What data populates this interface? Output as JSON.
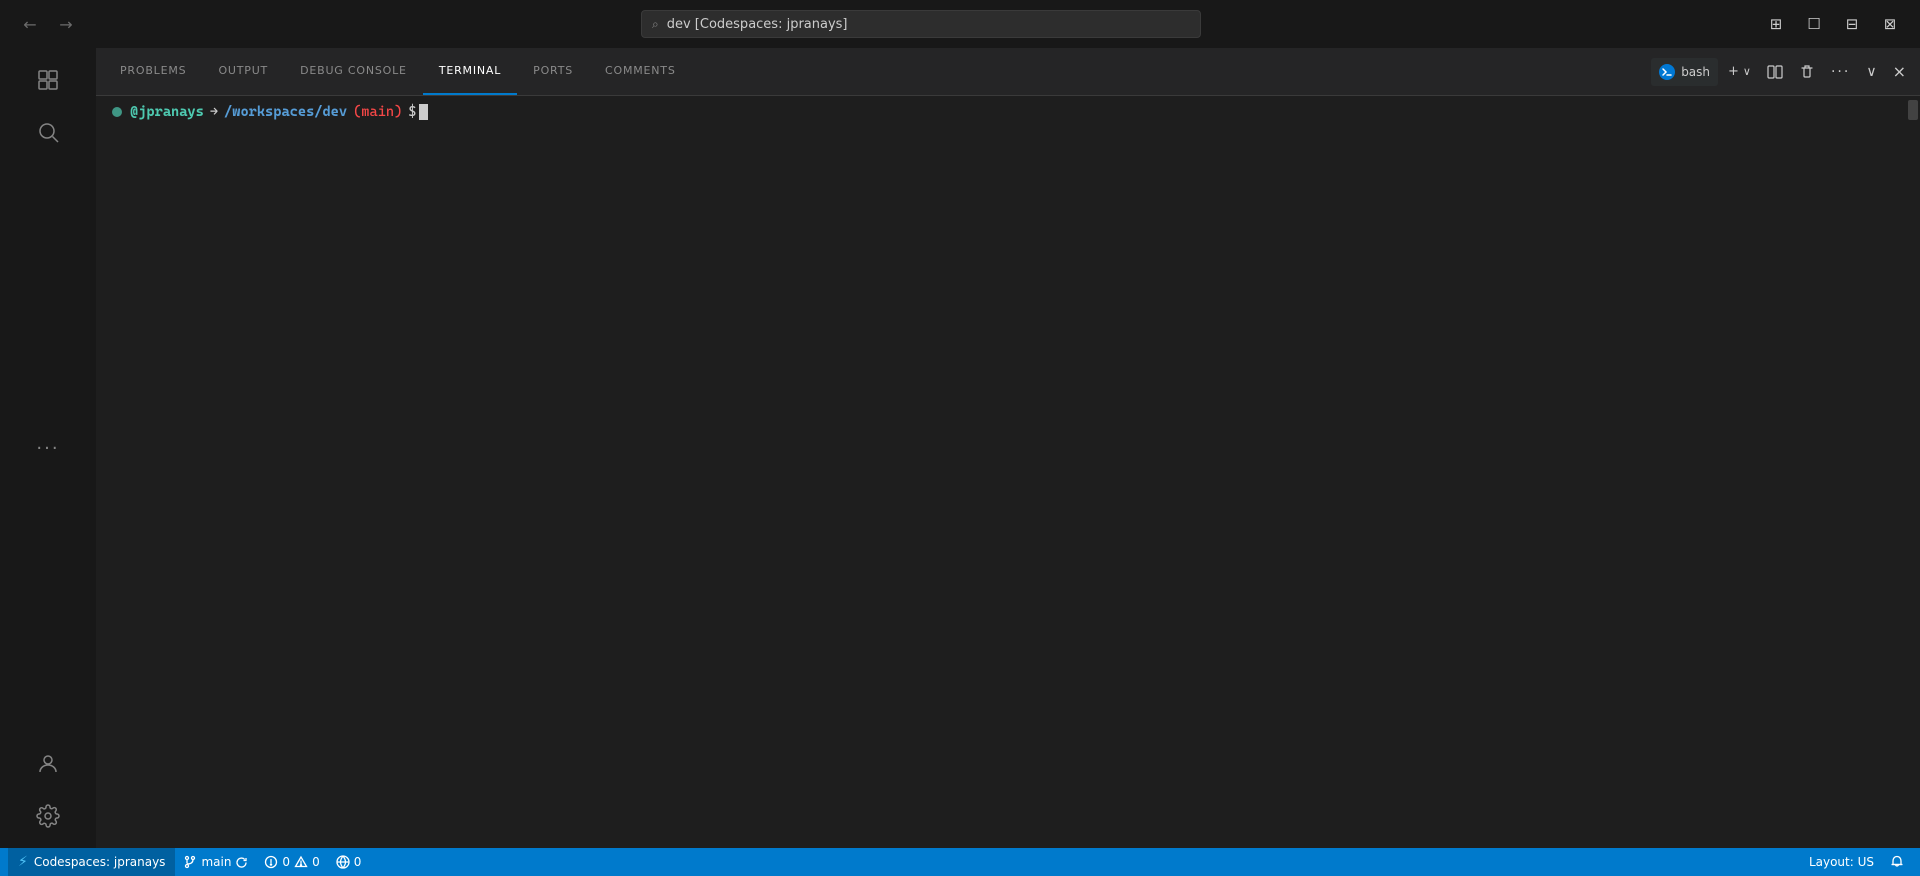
{
  "titlebar": {
    "back_arrow": "←",
    "forward_arrow": "→",
    "search_text": "dev [Codespaces: jpranays]",
    "search_icon": "⌕",
    "layout_icons": [
      "⊞",
      "☐",
      "⊟",
      "⊠"
    ]
  },
  "activity_bar": {
    "items": [
      {
        "name": "explorer",
        "icon": "⧉"
      },
      {
        "name": "search",
        "icon": "⌕"
      },
      {
        "name": "more",
        "icon": "···"
      },
      {
        "name": "account",
        "icon": "○"
      },
      {
        "name": "settings",
        "icon": "⚙"
      }
    ]
  },
  "panel": {
    "tabs": [
      {
        "id": "problems",
        "label": "PROBLEMS"
      },
      {
        "id": "output",
        "label": "OUTPUT"
      },
      {
        "id": "debug-console",
        "label": "DEBUG CONSOLE"
      },
      {
        "id": "terminal",
        "label": "TERMINAL",
        "active": true
      },
      {
        "id": "ports",
        "label": "PORTS"
      },
      {
        "id": "comments",
        "label": "COMMENTS"
      }
    ],
    "actions": {
      "bash_label": "bash",
      "add_icon": "+",
      "chevron_icon": "∨",
      "split_icon": "⊟",
      "trash_icon": "🗑",
      "more_icon": "···",
      "chevron_down": "∨",
      "close_icon": "×"
    }
  },
  "terminal": {
    "prompt_dot": "",
    "user": "@jpranays",
    "arrow": "→",
    "path": "/workspaces/dev",
    "branch": "(main)",
    "dollar": "$"
  },
  "status_bar": {
    "codespaces_icon": "⚡",
    "codespaces_label": "Codespaces: jpranays",
    "branch_icon": "⎇",
    "branch_label": "main",
    "sync_icon": "↻",
    "errors_icon": "⊗",
    "errors_count": "0",
    "warnings_icon": "⚠",
    "warnings_count": "0",
    "remote_icon": "📡",
    "remote_count": "0",
    "layout_label": "Layout: US",
    "bell_icon": "🔔"
  }
}
